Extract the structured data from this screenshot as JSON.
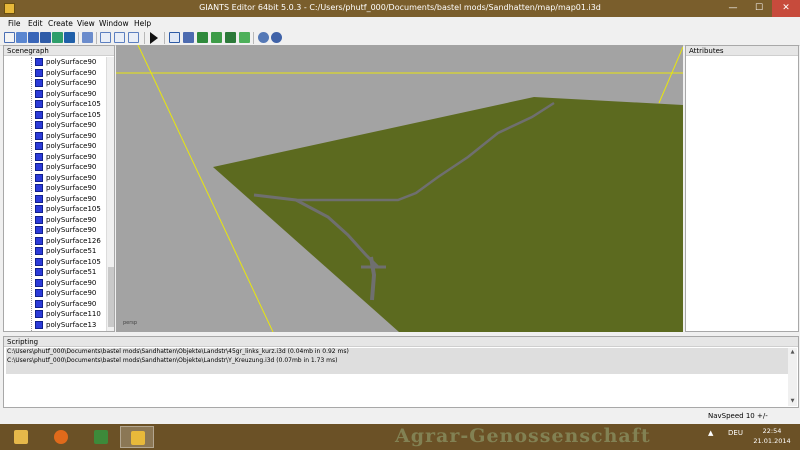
{
  "window": {
    "title": "GIANTS Editor 64bit 5.0.3 - C:/Users/phutf_000/Documents/bastel mods/Sandhatten/map/map01.i3d",
    "min_label": "—",
    "max_label": "☐",
    "close_label": "✕"
  },
  "menu": [
    "File",
    "Edit",
    "Create",
    "View",
    "Window",
    "Help"
  ],
  "toolbar": {
    "icons": [
      "new-icon",
      "open-icon",
      "save-icon",
      "save-as-icon",
      "import-icon",
      "export-icon",
      "delete-icon",
      "undo-icon",
      "redo-icon",
      "play-icon",
      "select-icon",
      "terrain-sculpt-icon",
      "terrain-paint-icon",
      "foliage-paint-icon",
      "grass-paint-icon",
      "settings-icon",
      "render-settings-icon"
    ]
  },
  "scenegraph": {
    "title": "Scenegraph",
    "nodes": [
      "polySurface90",
      "polySurface90",
      "polySurface90",
      "polySurface90",
      "polySurface105",
      "polySurface105",
      "polySurface90",
      "polySurface90",
      "polySurface90",
      "polySurface90",
      "polySurface90",
      "polySurface90",
      "polySurface90",
      "polySurface90",
      "polySurface105",
      "polySurface90",
      "polySurface90",
      "polySurface126",
      "polySurface51",
      "polySurface105",
      "polySurface51",
      "polySurface90",
      "polySurface90",
      "polySurface90",
      "polySurface110",
      "polySurface13"
    ]
  },
  "viewport": {
    "camera_label": "persp"
  },
  "attributes": {
    "title": "Attributes"
  },
  "scripting": {
    "title": "Scripting",
    "log": [
      "C:\\Users\\phutf_000\\Documents\\bastel mods\\Sandhatten\\Objekte\\Landstr\\45gr_links_kurz.i3d (0.04mb in 0.92 ms)",
      "C:\\Users\\phutf_000\\Documents\\bastel mods\\Sandhatten\\Objekte\\Landstr\\Y_Kreuzung.i3d (0.07mb in 1.73 ms)"
    ]
  },
  "status": {
    "navspeed": "NavSpeed 10 +/-"
  },
  "taskbar": {
    "apps": [
      "file-explorer-icon",
      "firefox-icon",
      "app-icon",
      "giants-editor-icon"
    ],
    "watermark": "Agrar-Genossenschaft",
    "language": "DEU",
    "time": "22:54",
    "date": "21.01.2014"
  },
  "colors": {
    "titlebar": "#7a5e2c",
    "terrain": "#5c6a1f",
    "viewport_bg": "#a3a3a3",
    "grid_line": "#e8e60e",
    "node_icon": "#2c3bd9"
  }
}
